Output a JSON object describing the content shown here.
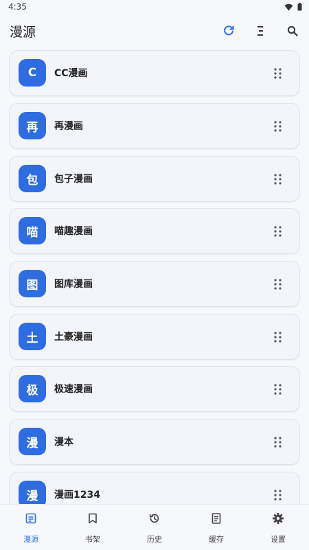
{
  "status": {
    "time": "4:35"
  },
  "header": {
    "title": "漫源",
    "icons": {
      "refresh": "refresh-icon",
      "sort": "sort-icon",
      "search": "search-icon"
    }
  },
  "sources": [
    {
      "avatar": "C",
      "name": "CC漫画"
    },
    {
      "avatar": "再",
      "name": "再漫画"
    },
    {
      "avatar": "包",
      "name": "包子漫画"
    },
    {
      "avatar": "喵",
      "name": "喵趣漫画"
    },
    {
      "avatar": "图",
      "name": "图库漫画"
    },
    {
      "avatar": "土",
      "name": "土豪漫画"
    },
    {
      "avatar": "极",
      "name": "极速漫画"
    },
    {
      "avatar": "漫",
      "name": "漫本"
    },
    {
      "avatar": "漫",
      "name": "漫画1234"
    }
  ],
  "nav": [
    {
      "label": "漫源",
      "icon": "sources-icon",
      "active": true
    },
    {
      "label": "书架",
      "icon": "bookmark-icon",
      "active": false
    },
    {
      "label": "历史",
      "icon": "history-icon",
      "active": false
    },
    {
      "label": "缓存",
      "icon": "cache-icon",
      "active": false
    },
    {
      "label": "设置",
      "icon": "settings-icon",
      "active": false
    }
  ],
  "colors": {
    "accent": "#2f6ce1",
    "background": "#f7f8fc",
    "card": "#f3f5fb"
  }
}
